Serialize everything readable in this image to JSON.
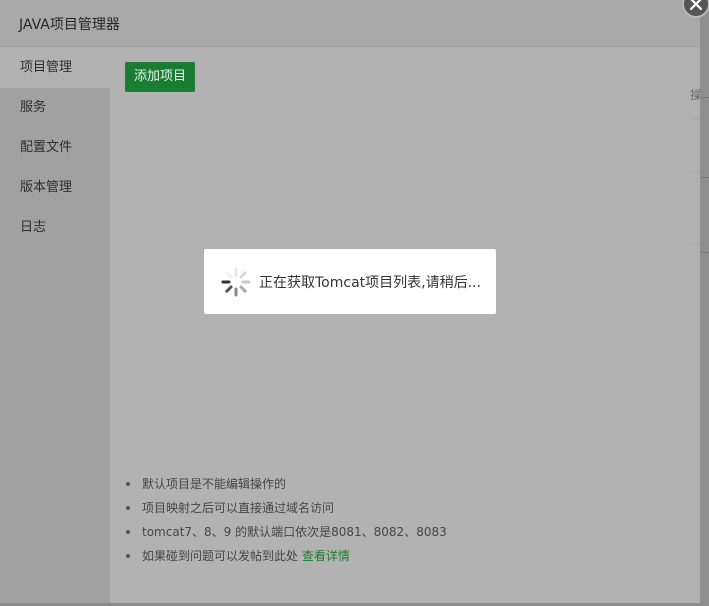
{
  "dialog": {
    "title": "JAVA项目管理器",
    "close_icon": "close-icon"
  },
  "sidebar": {
    "items": [
      {
        "label": "项目管理",
        "active": true
      },
      {
        "label": "服务",
        "active": false
      },
      {
        "label": "配置文件",
        "active": false
      },
      {
        "label": "版本管理",
        "active": false
      },
      {
        "label": "日志",
        "active": false
      }
    ]
  },
  "content": {
    "add_button_label": "添加项目",
    "accent_color": "#20a53a",
    "background_partial_text": "操"
  },
  "notes": [
    {
      "text": "默认项目是不能编辑操作的"
    },
    {
      "text": "项目映射之后可以直接通过域名访问"
    },
    {
      "text": "tomcat7、8、9 的默认端口依次是8081、8082、8083"
    },
    {
      "text": "如果碰到问题可以发帖到此处 ",
      "link": "查看详情"
    }
  ],
  "loading": {
    "icon": "loading-spinner-icon",
    "text": "正在获取Tomcat项目列表,请稍后..."
  }
}
